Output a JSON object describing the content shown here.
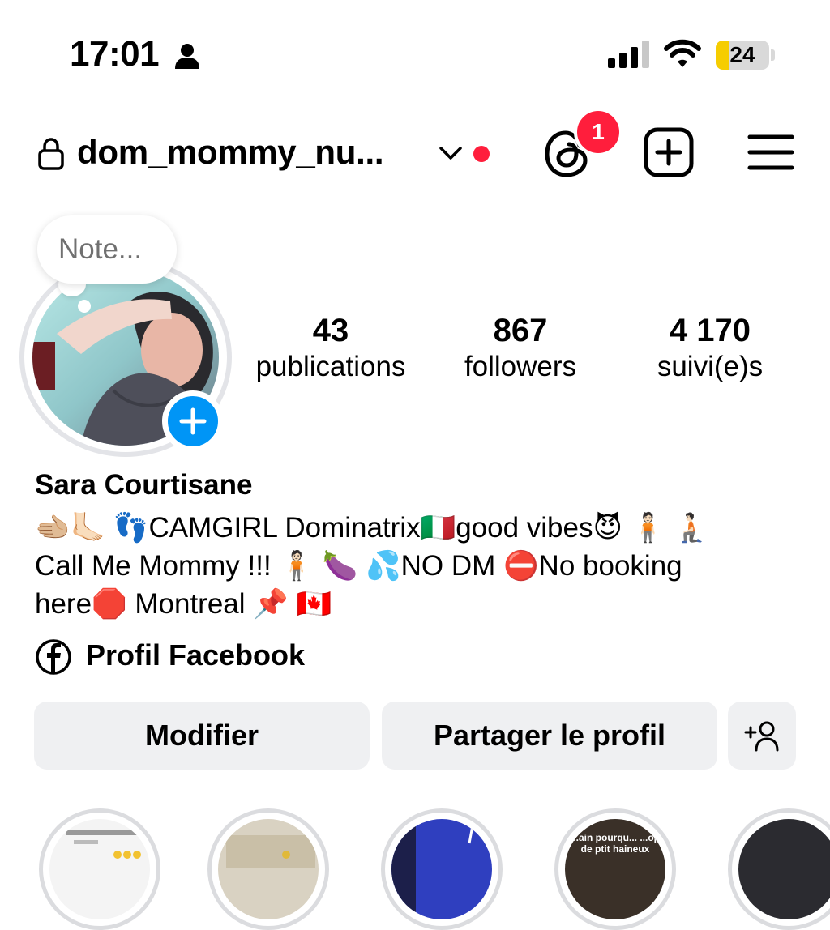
{
  "status_bar": {
    "time": "17:01",
    "battery_level": "24",
    "battery_fraction": 0.24
  },
  "header": {
    "username": "dom_mommy_nu...",
    "threads_badge": "1"
  },
  "profile": {
    "note_placeholder": "Note...",
    "stats": [
      {
        "value": "43",
        "label": "publications"
      },
      {
        "value": "867",
        "label": "followers"
      },
      {
        "value": "4 170",
        "label": "suivi(e)s"
      }
    ],
    "name": "Sara Courtisane",
    "bio_lines": [
      "🫲🏼🦶🏻 👣CAMGIRL Dominatrix🇮🇹good vibes😈 🧍🏻 🧎🏻",
      "Call Me Mommy !!! 🧍🏻 🍆 💦NO DM ⛔No booking",
      "here🛑 Montreal 📌 🇨🇦"
    ],
    "facebook_link": "Profil Facebook"
  },
  "actions": {
    "edit_label": "Modifier",
    "share_label": "Partager le profil"
  },
  "highlights": [
    {
      "caption": ""
    },
    {
      "caption": ""
    },
    {
      "caption": ""
    },
    {
      "caption": "...ain pourqu... ...op de ptit haineux"
    },
    {
      "caption": ""
    }
  ],
  "colors": {
    "accent_blue": "#0095f6",
    "badge_red": "#ff1e3c",
    "battery_yellow": "#f6cd00",
    "button_bg": "#eff0f2"
  },
  "icons": [
    "person-icon",
    "signal-icon",
    "wifi-icon",
    "battery-icon",
    "lock-icon",
    "chevron-down-icon",
    "threads-icon",
    "add-post-icon",
    "menu-icon",
    "add-story-icon",
    "facebook-icon",
    "add-person-icon"
  ]
}
